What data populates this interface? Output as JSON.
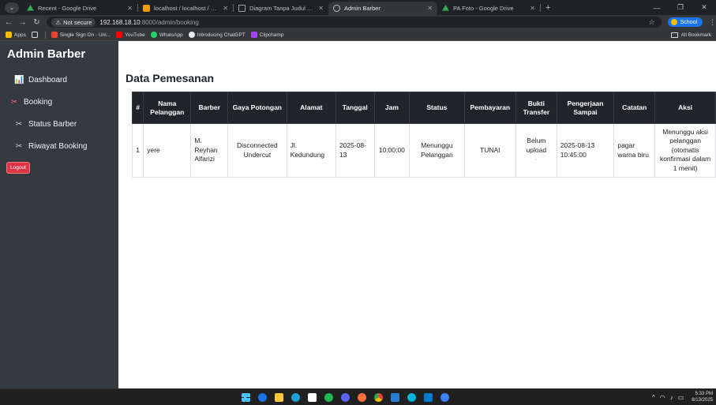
{
  "browser": {
    "tabs": [
      {
        "title": "Recent - Google Drive",
        "favicon_color": "#34a853"
      },
      {
        "title": "localhost / localhost / barber / ",
        "favicon_color": "#f29900"
      },
      {
        "title": "Diagram Tanpa Judul - draw.io",
        "favicon_color": "#9aa0a6"
      },
      {
        "title": "Admin Barber",
        "favicon_color": "#9aa0a6",
        "active": true
      },
      {
        "title": "PA Foto - Google Drive",
        "favicon_color": "#34a853"
      }
    ],
    "not_secure": "Not secure",
    "url_host": "192.168.18.10",
    "url_path": ":8000/admin/booking",
    "profile": "School",
    "bookmarks": [
      {
        "label": "Apps",
        "color": "#fbbc04"
      },
      {
        "label": "Single Sign On - Uni...",
        "color": "#ea4335"
      },
      {
        "label": "YouTube",
        "color": "#ff0000"
      },
      {
        "label": "WhatsApp",
        "color": "#25d366"
      },
      {
        "label": "Introducing ChatGPT",
        "color": "#e8eaed"
      },
      {
        "label": "Clipchamp",
        "color": "#a142f4"
      }
    ],
    "all_bookmarks": "All Bookmark"
  },
  "sidebar": {
    "brand": "Admin Barber",
    "items": [
      {
        "label": "Dashboard",
        "icon": "📊"
      },
      {
        "label": "Booking",
        "icon": "✂"
      },
      {
        "label": "Status Barber",
        "icon": "✂"
      },
      {
        "label": "Riwayat Booking",
        "icon": "✂"
      }
    ],
    "logout": "Logout"
  },
  "main": {
    "title": "Data Pemesanan",
    "table": {
      "headers": [
        "#",
        "Nama Pelanggan",
        "Barber",
        "Gaya Potongan",
        "Alamat",
        "Tanggal",
        "Jam",
        "Status",
        "Pembayaran",
        "Bukti Transfer",
        "Pengerjaan Sampai",
        "Catatan",
        "Aksi"
      ],
      "rows": [
        {
          "no": "1",
          "nama": "yere",
          "barber": "M. Reyhan Alfarizi",
          "gaya": "Disconnected Undercut",
          "alamat": "Jl. Kedundung",
          "tanggal": "2025-08-13",
          "jam": "10:00:00",
          "status": "Menunggu Pelanggan",
          "pembayaran": "TUNAI",
          "bukti": "Belum upload",
          "bukti_sub": "-",
          "sampai": "2025-08-13 10:45:00",
          "catatan": "pagar warna biru",
          "aksi": "Menunggu aksi pelanggan (otomatis konfirmasi dalam 1 menit)"
        }
      ]
    }
  },
  "taskbar": {
    "apps": [
      {
        "name": "start",
        "color": "#4cc2ff"
      },
      {
        "name": "app-2",
        "color": "#f7b500"
      },
      {
        "name": "file-explorer",
        "color": "#ffc83d"
      },
      {
        "name": "edge",
        "color": "#1ba0d7"
      },
      {
        "name": "app-5",
        "color": "#0078d4"
      },
      {
        "name": "spotify",
        "color": "#1db954"
      },
      {
        "name": "app-7",
        "color": "#5865f2"
      },
      {
        "name": "app-8",
        "color": "#ff6f3c"
      },
      {
        "name": "chrome",
        "color": "#34a853"
      },
      {
        "name": "app-10",
        "color": "#2b7cd3"
      },
      {
        "name": "app-11",
        "color": "#00b4d8"
      },
      {
        "name": "vscode",
        "color": "#007acc"
      },
      {
        "name": "app-13",
        "color": "#3b82f6"
      }
    ],
    "time": "5:33 PM",
    "date": "8/13/2025"
  }
}
